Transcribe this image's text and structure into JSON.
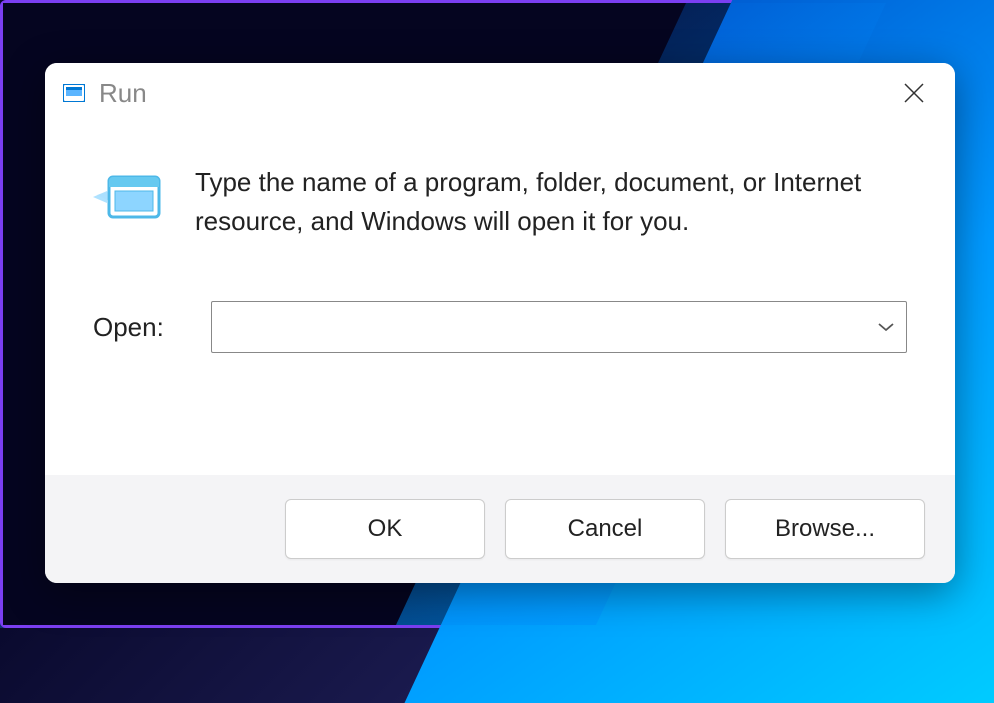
{
  "titlebar": {
    "title": "Run"
  },
  "body": {
    "instruction": "Type the name of a program, folder, document, or Internet resource, and Windows will open it for you.",
    "open_label": "Open:",
    "open_value": ""
  },
  "buttons": {
    "ok": "OK",
    "cancel": "Cancel",
    "browse": "Browse..."
  }
}
